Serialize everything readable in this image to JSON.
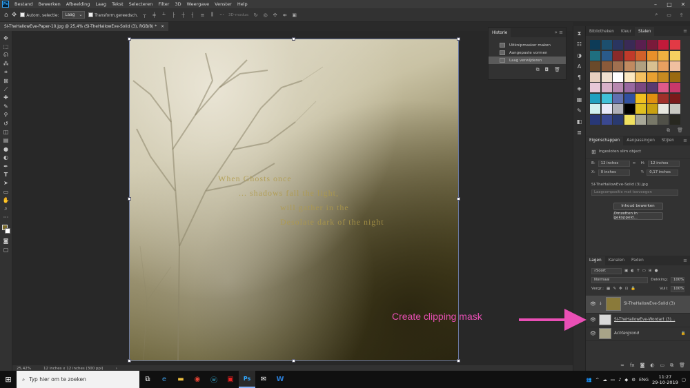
{
  "menubar": {
    "logo": "Ps",
    "items": [
      "Bestand",
      "Bewerken",
      "Afbeelding",
      "Laag",
      "Tekst",
      "Selecteren",
      "Filter",
      "3D",
      "Weergave",
      "Venster",
      "Help"
    ]
  },
  "options": {
    "auto_select_label": "Autom. selectie:",
    "auto_select_value": "Laag",
    "transform_label": "Transform.gereedsch.",
    "mode_3d_label": "3D-modus:"
  },
  "document_tab": {
    "title": "SI-TheHallowEve-Paper-10.jpg @ 25,4% (SI-TheHallowEve-Solid (3), RGB/8) *",
    "close": "×"
  },
  "status": {
    "zoom": "25,42%",
    "doc_size": "12 inches x 12 inches (300 ppi)"
  },
  "artwork": {
    "line1": "When Ghosts once ",
    "line2": "... shadows fall the light,",
    "line3": "will gather in the",
    "line4": "Desolate dark of the night"
  },
  "history": {
    "title": "Historie",
    "items": [
      "Uitknipmasker maken",
      "Aangepaste vormen",
      "Laag verwijderen"
    ]
  },
  "swatches_panel": {
    "tabs": [
      "Bibliotheken",
      "Kleur",
      "Stalen"
    ],
    "colors": [
      "#0d3b57",
      "#1c4f6e",
      "#2a3560",
      "#3a2a55",
      "#5a1f4f",
      "#7a1a3a",
      "#c21a3a",
      "#e23a45",
      "#1f6f7f",
      "#2a5a8a",
      "#8a2a2a",
      "#c03a2a",
      "#d0602a",
      "#e8902a",
      "#f0b040",
      "#f5d060",
      "#6a4a2a",
      "#8a5a3a",
      "#a07050",
      "#c08a60",
      "#b0a080",
      "#d8c090",
      "#e8a060",
      "#f0c0a0",
      "#e8d0c0",
      "#f0e0d0",
      "#ffffff",
      "#fbe8c0",
      "#f3c060",
      "#e8a030",
      "#c88a20",
      "#9a6a10",
      "#e8c8d8",
      "#d8b0c8",
      "#b888b0",
      "#9868a0",
      "#7a4880",
      "#5a3a70",
      "#e05a8a",
      "#c8386a",
      "#20a0c0",
      "#40c0d8",
      "#6070b0",
      "#3050a0",
      "#f0c020",
      "#e09010",
      "#a0302a",
      "#7a1a1a",
      "#d0f0f0",
      "#e8e8f8",
      "#b0b0b8",
      "#000000",
      "#e0c020",
      "#c8a010",
      "#e8e8e0",
      "#c8c8c0",
      "#283878",
      "#3a4890",
      "#2a3a70",
      "#f0e060",
      "#a8a898",
      "#787868",
      "#505048",
      "#282820"
    ]
  },
  "properties": {
    "tabs": [
      "Eigenschappen",
      "Aanpassingen",
      "Stijlen"
    ],
    "type_label": "Ingesloten slim object",
    "b_label": "B:",
    "b_value": "12 inches",
    "h_label": "H:",
    "h_value": "12 inches",
    "x_label": "X:",
    "x_value": "0 inches",
    "y_label": "Y:",
    "y_value": "0,17 inches",
    "filename": "SI-TheHallowEve-Solid (3).jpg",
    "comp_placeholder": "Laagcompositie met toevoegen",
    "edit_button": "Inhoud bewerken",
    "convert_button": "Omzetten in gekoppeld..."
  },
  "layers_panel": {
    "tabs": [
      "Lagen",
      "Kanalen",
      "Paden"
    ],
    "filter_label": "Soort",
    "blend_mode": "Normaal",
    "opacity_label": "Dekking:",
    "opacity_value": "100%",
    "lock_label": "Vergr.:",
    "fill_label": "Vull:",
    "fill_value": "100%",
    "layers": [
      {
        "name": "SI-TheHallowEve-Solid (3)",
        "thumb": "#8a7a3a"
      },
      {
        "name": "SI-TheHallowEve-Wordart (3)...",
        "thumb": "#d8d8d8"
      },
      {
        "name": "Achtergrond",
        "thumb": "#a8a488"
      }
    ]
  },
  "annotation": {
    "text": "Create clipping mask",
    "color": "#e94fb5"
  },
  "taskbar": {
    "search_placeholder": "Typ hier om te zoeken",
    "lang": "ENG",
    "time": "11:27",
    "date": "29-10-2019"
  }
}
